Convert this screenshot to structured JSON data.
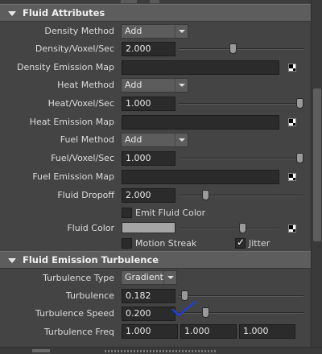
{
  "fluid_attributes": {
    "header": "Fluid Attributes",
    "density_method": {
      "label": "Density Method",
      "value": "Add"
    },
    "density_voxel_sec": {
      "label": "Density/Voxel/Sec",
      "value": "2.000",
      "slider": 0.43
    },
    "density_emission_map": {
      "label": "Density Emission Map"
    },
    "heat_method": {
      "label": "Heat Method",
      "value": "Add"
    },
    "heat_voxel_sec": {
      "label": "Heat/Voxel/Sec",
      "value": "1.000",
      "slider": 1.0
    },
    "heat_emission_map": {
      "label": "Heat Emission Map"
    },
    "fuel_method": {
      "label": "Fuel Method",
      "value": "Add"
    },
    "fuel_voxel_sec": {
      "label": "Fuel/Voxel/Sec",
      "value": "1.000",
      "slider": 1.0
    },
    "fuel_emission_map": {
      "label": "Fuel Emission Map"
    },
    "fluid_dropoff": {
      "label": "Fluid Dropoff",
      "value": "2.000",
      "slider": 0.2
    },
    "emit_fluid_color": {
      "label": "Emit Fluid Color",
      "checked": false
    },
    "fluid_color": {
      "label": "Fluid Color",
      "color": "#a5a5a5",
      "slider": 0.65
    },
    "motion_streak": {
      "label": "Motion Streak",
      "checked": false
    },
    "jitter": {
      "label": "Jitter",
      "checked": true
    }
  },
  "fluid_emission_turbulence": {
    "header": "Fluid Emission Turbulence",
    "turbulence_type": {
      "label": "Turbulence Type",
      "value": "Gradient"
    },
    "turbulence": {
      "label": "Turbulence",
      "value": "0.182",
      "slider": 0.02
    },
    "turbulence_speed": {
      "label": "Turbulence Speed",
      "value": "0.200",
      "slider": 0.2
    },
    "turbulence_freq": {
      "label": "Turbulence Freq",
      "values": [
        "1.000",
        "1.000",
        "1.000"
      ]
    }
  },
  "icons": {
    "section_toggle": "triangle-down-icon",
    "map_button": "checker-map-icon",
    "annotation": "blue-checkmark-icon"
  },
  "colors": {
    "panel_bg": "#444444",
    "header_bg": "#5d5d5d",
    "field_bg": "#2b2b2b",
    "annotation": "#1e3fd8"
  }
}
